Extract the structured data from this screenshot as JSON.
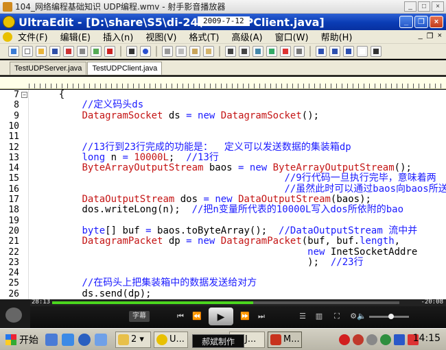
{
  "player": {
    "title": "104_网络编程基础知识  UDP编程.wmv - 射手影音播放器",
    "controls": {
      "current_time": "28:13",
      "remaining_time": "-20:08",
      "subtitle_label": "字幕",
      "progress_percent": 58,
      "volume_percent": 55
    }
  },
  "overlay_date": "2009-7-12",
  "editor_window": {
    "title": "UltraEdit - [D:\\share\\S5\\di-24\\TestUDPClient.java]",
    "menu": [
      "文件(F)",
      "编辑(E)",
      "插入(n)",
      "视图(V)",
      "格式(T)",
      "高级(A)",
      "窗口(W)",
      "帮助(H)"
    ],
    "tabs": [
      "TestUDPServer.java",
      "TestUDPClient.java"
    ],
    "active_tab": "TestUDPClient.java",
    "lines": [
      {
        "num": "7",
        "fold": "−",
        "tokens": [
          {
            "t": "    {",
            "c": ""
          }
        ]
      },
      {
        "num": "8",
        "tokens": [
          {
            "t": "        //定义码头ds",
            "c": "cm"
          }
        ]
      },
      {
        "num": "9",
        "tokens": [
          {
            "t": "        ",
            "c": ""
          },
          {
            "t": "DatagramSocket",
            "c": "ty"
          },
          {
            "t": " ds ",
            "c": ""
          },
          {
            "t": "=",
            "c": "kw"
          },
          {
            "t": " ",
            "c": ""
          },
          {
            "t": "new",
            "c": "kw"
          },
          {
            "t": " ",
            "c": ""
          },
          {
            "t": "DatagramSocket",
            "c": "ty"
          },
          {
            "t": "();",
            "c": ""
          }
        ]
      },
      {
        "num": "10",
        "tokens": []
      },
      {
        "num": "11",
        "tokens": []
      },
      {
        "num": "12",
        "tokens": [
          {
            "t": "        //13行到23行完成的功能是：  定义可以发送数据的集装箱dp",
            "c": "cm"
          }
        ]
      },
      {
        "num": "13",
        "tokens": [
          {
            "t": "        ",
            "c": ""
          },
          {
            "t": "long",
            "c": "kw"
          },
          {
            "t": " n ",
            "c": ""
          },
          {
            "t": "=",
            "c": "kw"
          },
          {
            "t": " ",
            "c": ""
          },
          {
            "t": "10000L",
            "c": "nm"
          },
          {
            "t": ";  ",
            "c": ""
          },
          {
            "t": "//13行",
            "c": "cm"
          }
        ]
      },
      {
        "num": "14",
        "tokens": [
          {
            "t": "        ",
            "c": ""
          },
          {
            "t": "ByteArrayOutputStream",
            "c": "ty"
          },
          {
            "t": " baos ",
            "c": ""
          },
          {
            "t": "=",
            "c": "kw"
          },
          {
            "t": " ",
            "c": ""
          },
          {
            "t": "new",
            "c": "kw"
          },
          {
            "t": " ",
            "c": ""
          },
          {
            "t": "ByteArrayOutputStream",
            "c": "ty"
          },
          {
            "t": "();",
            "c": ""
          }
        ]
      },
      {
        "num": "15",
        "tokens": [
          {
            "t": "                                           ",
            "c": ""
          },
          {
            "t": "//9行代码一旦执行完毕，意味着两",
            "c": "cm"
          }
        ]
      },
      {
        "num": "16",
        "tokens": [
          {
            "t": "                                           ",
            "c": ""
          },
          {
            "t": "//虽然此时可以通过baos向baos所送",
            "c": "cm"
          }
        ]
      },
      {
        "num": "17",
        "tokens": [
          {
            "t": "        ",
            "c": ""
          },
          {
            "t": "DataOutputStream",
            "c": "ty"
          },
          {
            "t": " dos ",
            "c": ""
          },
          {
            "t": "=",
            "c": "kw"
          },
          {
            "t": " ",
            "c": ""
          },
          {
            "t": "new",
            "c": "kw"
          },
          {
            "t": " ",
            "c": ""
          },
          {
            "t": "DataOutputStream",
            "c": "ty"
          },
          {
            "t": "(baos);",
            "c": ""
          }
        ]
      },
      {
        "num": "18",
        "tokens": [
          {
            "t": "        dos.writeLong(n);  ",
            "c": ""
          },
          {
            "t": "//把n变量所代表的10000L写入dos所依附的bao",
            "c": "cm"
          }
        ]
      },
      {
        "num": "19",
        "tokens": []
      },
      {
        "num": "20",
        "tokens": [
          {
            "t": "        ",
            "c": ""
          },
          {
            "t": "byte",
            "c": "kw"
          },
          {
            "t": "[] buf ",
            "c": ""
          },
          {
            "t": "=",
            "c": "kw"
          },
          {
            "t": " baos.toByteArray();  ",
            "c": ""
          },
          {
            "t": "//DataOutputStream 流中并",
            "c": "cm"
          }
        ]
      },
      {
        "num": "21",
        "tokens": [
          {
            "t": "        ",
            "c": ""
          },
          {
            "t": "DatagramPacket",
            "c": "ty"
          },
          {
            "t": " dp ",
            "c": ""
          },
          {
            "t": "=",
            "c": "kw"
          },
          {
            "t": " ",
            "c": ""
          },
          {
            "t": "new",
            "c": "kw"
          },
          {
            "t": " ",
            "c": ""
          },
          {
            "t": "DatagramPacket",
            "c": "ty"
          },
          {
            "t": "(buf, buf.",
            "c": ""
          },
          {
            "t": "length",
            "c": "kw"
          },
          {
            "t": ",",
            "c": ""
          }
        ]
      },
      {
        "num": "22",
        "tokens": [
          {
            "t": "                                               ",
            "c": ""
          },
          {
            "t": "new",
            "c": "kw"
          },
          {
            "t": " InetSocketAddre",
            "c": ""
          }
        ]
      },
      {
        "num": "23",
        "tokens": [
          {
            "t": "                                               );  ",
            "c": ""
          },
          {
            "t": "//23行",
            "c": "cm"
          }
        ]
      },
      {
        "num": "24",
        "tokens": []
      },
      {
        "num": "25",
        "tokens": [
          {
            "t": "        //在码头上把集装箱中的数据发送给对方",
            "c": "cm"
          }
        ]
      },
      {
        "num": "26",
        "tokens": [
          {
            "t": "        ds.send(dp);",
            "c": ""
          }
        ]
      }
    ]
  },
  "taskbar": {
    "start_label": "开始",
    "tasks": [
      {
        "label": "2 ▾"
      },
      {
        "label": "U..."
      },
      {
        "label": "J..."
      },
      {
        "label": "M..."
      }
    ],
    "caption_box": "郝斌制作",
    "clock": "14:15"
  },
  "colors": {
    "keyword": "#1a1aff",
    "type": "#c41414",
    "comment": "#1a1aff",
    "title_bar": "#0a3cb4",
    "seek_fill": "#4bd61e"
  }
}
